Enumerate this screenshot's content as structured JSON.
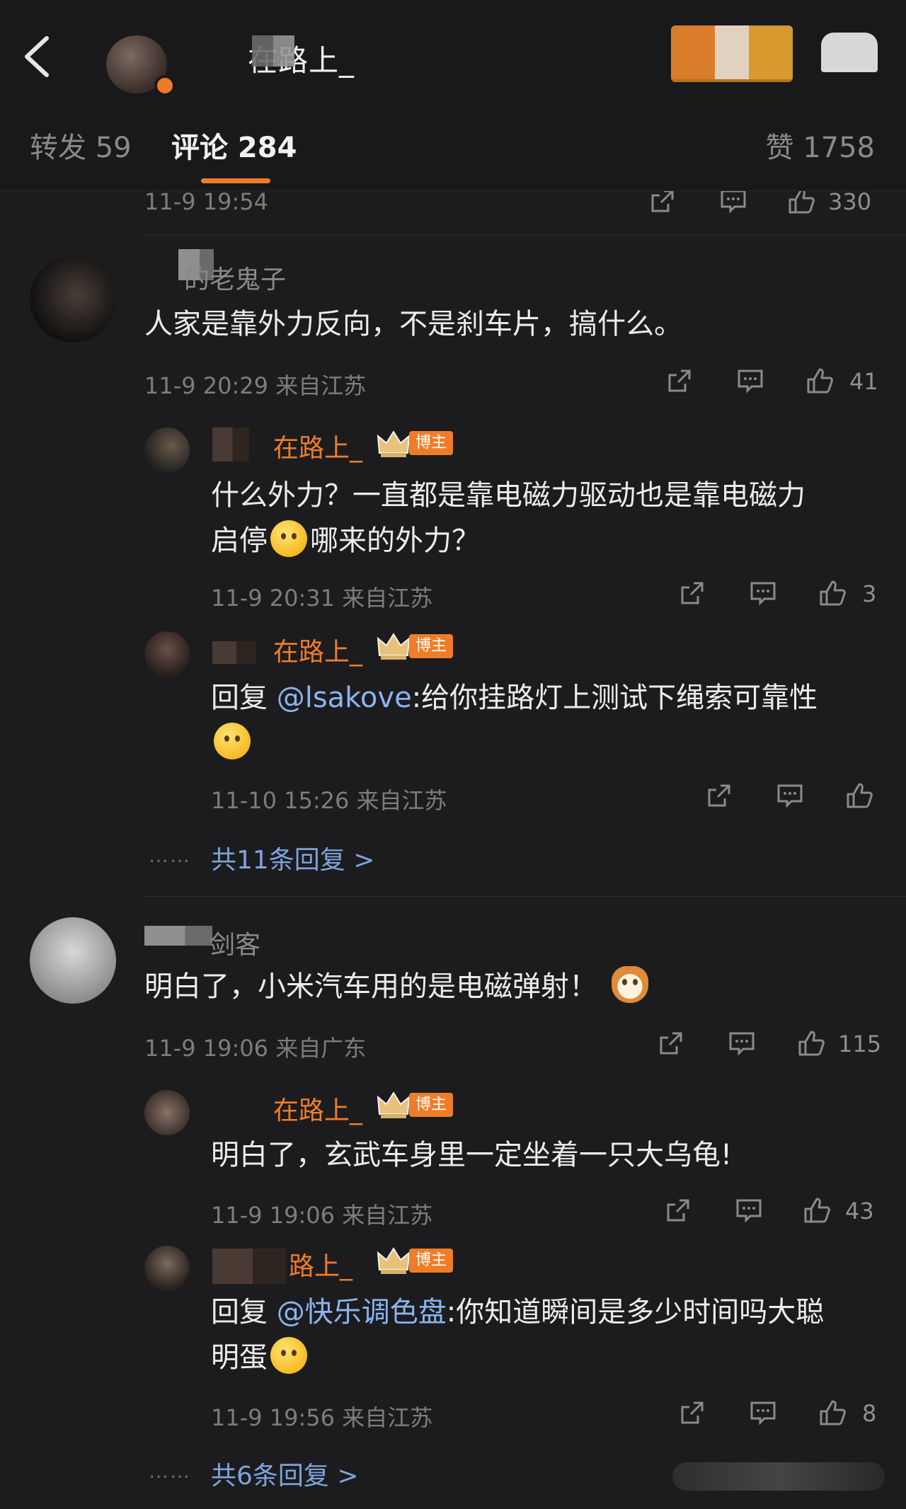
{
  "header": {
    "title": "在路上_",
    "tabs": {
      "forward": "转发 59",
      "comments": "评论 284",
      "likes": "赞 1758"
    }
  },
  "partial_row": {
    "time": "11-9 19:54",
    "likes": "330"
  },
  "comments": [
    {
      "name": "的老鬼子",
      "text": "人家是靠外力反向，不是刹车片，搞什么。",
      "meta": "11-9 20:29 来自江苏",
      "likes": "41",
      "replies": [
        {
          "name": "在路上_",
          "badge": "博主",
          "text_line1": "什么外力？一直都是靠电磁力驱动也是靠电磁力",
          "text_line2_a": "启停",
          "text_line2_b": "哪来的外力？",
          "meta": "11-9 20:31 来自江苏",
          "likes": "3"
        },
        {
          "name": "在路上_",
          "badge": "博主",
          "reply_prefix": "回复 ",
          "mention": "@lsakove",
          "text": ":给你挂路灯上测试下绳索可靠性",
          "meta": "11-10 15:26 来自江苏",
          "likes": ""
        }
      ],
      "more_replies": "共11条回复 >"
    },
    {
      "name": "剑客",
      "text": "明白了，小米汽车用的是电磁弹射！",
      "meta": "11-9 19:06 来自广东",
      "likes": "115",
      "replies": [
        {
          "name": "在路上_",
          "badge": "博主",
          "text": "明白了，玄武车身里一定坐着一只大乌龟!",
          "meta": "11-9 19:06 来自江苏",
          "likes": "43"
        },
        {
          "name": "路上_",
          "badge": "博主",
          "reply_prefix": "回复 ",
          "mention": "@快乐调色盘",
          "text_line1": ":你知道瞬间是多少时间吗大聪",
          "text_line2": "明蛋",
          "meta": "11-9 19:56 来自江苏",
          "likes": "8"
        }
      ],
      "more_replies": "共6条回复 >"
    }
  ],
  "ellipsis": "……",
  "colors": {
    "accent": "#ef7d28",
    "mention": "#8ab4ef",
    "background": "#1c1c1e"
  }
}
